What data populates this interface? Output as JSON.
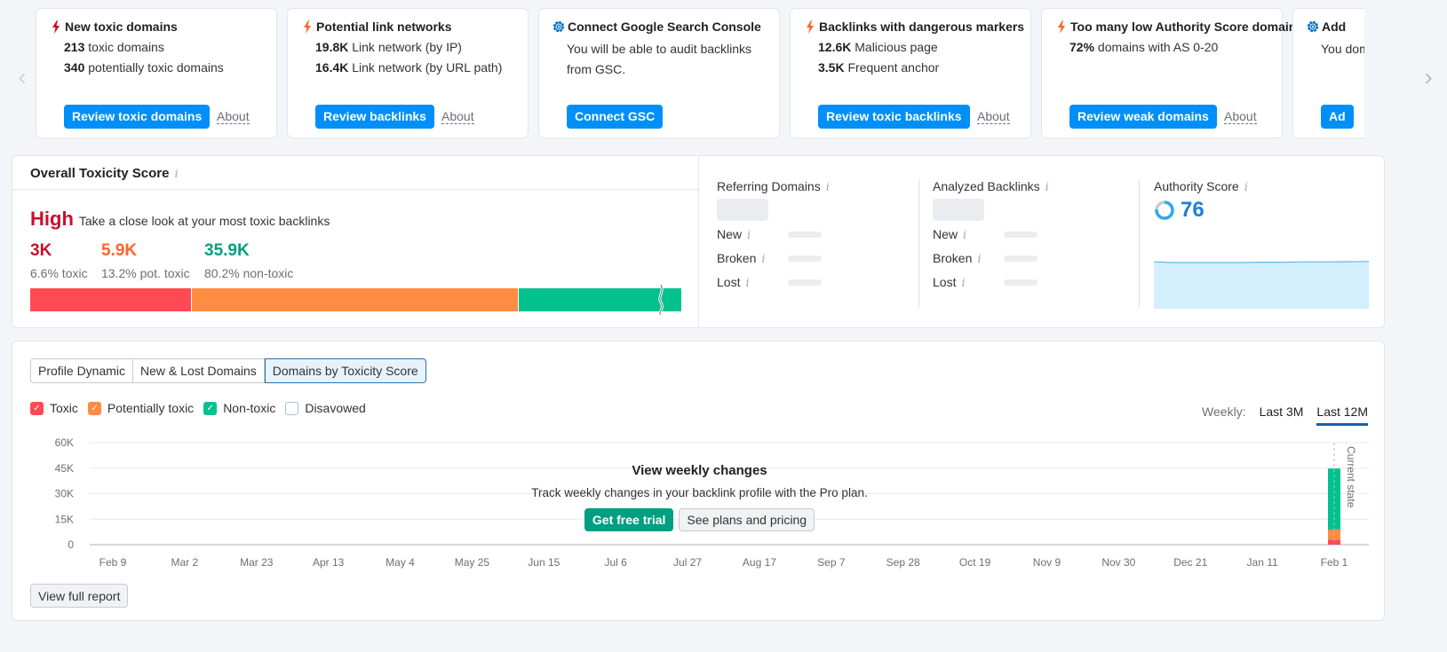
{
  "carousel": {
    "cards": [
      {
        "icon": "lightning-icon",
        "icon_color": "#d1002f",
        "title": "New toxic domains",
        "lines": [
          {
            "value": "213",
            "text": " toxic domains"
          },
          {
            "value": "340",
            "text": " potentially toxic domains"
          }
        ],
        "button": "Review toxic domains",
        "about": "About"
      },
      {
        "icon": "lightning-icon",
        "icon_color": "#ff642d",
        "title": "Potential link networks",
        "lines": [
          {
            "value": "19.8K",
            "text": " Link network (by IP)"
          },
          {
            "value": "16.4K",
            "text": " Link network (by URL path)"
          }
        ],
        "button": "Review backlinks",
        "about": "About"
      },
      {
        "icon": "gear-icon",
        "icon_color": "#006dca",
        "title": "Connect Google Search Console",
        "description": "You will be able to audit backlinks from GSC.",
        "button": "Connect GSC"
      },
      {
        "icon": "lightning-icon",
        "icon_color": "#ff642d",
        "title": "Backlinks with dangerous markers",
        "lines": [
          {
            "value": "12.6K",
            "text": " Malicious page"
          },
          {
            "value": "3.5K",
            "text": " Frequent anchor"
          }
        ],
        "button": "Review toxic backlinks",
        "about": "About"
      },
      {
        "icon": "lightning-icon",
        "icon_color": "#ff642d",
        "title": "Too many low Authority Score domains",
        "lines": [
          {
            "value": "72%",
            "text": " domains with AS 0-20"
          }
        ],
        "button": "Review weak domains",
        "about": "About"
      },
      {
        "icon": "gear-icon",
        "icon_color": "#006dca",
        "title": "Add",
        "description": "You dom",
        "button": "Ad"
      }
    ]
  },
  "toxicity": {
    "title": "Overall Toxicity Score",
    "level": "High",
    "level_text": "Take a close look at your most toxic backlinks",
    "metrics": [
      {
        "value": "3K",
        "label": "6.6% toxic",
        "color": "#c8102e"
      },
      {
        "value": "5.9K",
        "label": "13.2% pot. toxic",
        "color": "#ff642d"
      },
      {
        "value": "35.9K",
        "label": "80.2% non-toxic",
        "color": "#009f81"
      }
    ],
    "bar": [
      {
        "name": "toxic",
        "share": 0.247,
        "color": "#ff4953"
      },
      {
        "name": "potentially-toxic",
        "share": 0.502,
        "color": "#ff8c43"
      },
      {
        "name": "non-toxic",
        "share": 0.251,
        "color": "#00c28f"
      }
    ]
  },
  "stats": {
    "referring_domains": {
      "title": "Referring Domains",
      "rows": [
        "New",
        "Broken",
        "Lost"
      ]
    },
    "analyzed_backlinks": {
      "title": "Analyzed Backlinks",
      "rows": [
        "New",
        "Broken",
        "Lost"
      ]
    },
    "authority_score": {
      "title": "Authority Score",
      "value": "76",
      "ring_fraction": 0.76,
      "trend": [
        76,
        75,
        75,
        75,
        75,
        75.5,
        75.5,
        76,
        76,
        76.3,
        76.5
      ]
    }
  },
  "profile": {
    "tabs": [
      {
        "label": "Profile Dynamic",
        "active": false
      },
      {
        "label": "New & Lost Domains",
        "active": false
      },
      {
        "label": "Domains by Toxicity Score",
        "active": true
      }
    ],
    "legend": [
      {
        "label": "Toxic",
        "checked": true,
        "color": "#ff4953"
      },
      {
        "label": "Potentially toxic",
        "checked": true,
        "color": "#ff8c43"
      },
      {
        "label": "Non-toxic",
        "checked": true,
        "color": "#00c28f"
      },
      {
        "label": "Disavowed",
        "checked": false,
        "color": "#ffffff"
      }
    ],
    "period_label": "Weekly:",
    "periods": [
      {
        "label": "Last 3M",
        "active": false
      },
      {
        "label": "Last 12M",
        "active": true
      }
    ],
    "overlay": {
      "title": "View weekly changes",
      "subtitle": "Track weekly changes in your backlink profile with the Pro plan.",
      "primary": "Get free trial",
      "secondary": "See plans and pricing"
    },
    "view_full_report": "View full report"
  },
  "chart_data": {
    "type": "bar",
    "title": "Domains by Toxicity Score",
    "xlabel": "",
    "ylabel": "",
    "ylim": [
      0,
      60000
    ],
    "yticks": [
      "0",
      "15K",
      "30K",
      "45K",
      "60K"
    ],
    "categories": [
      "Feb 9",
      "Mar 2",
      "Mar 23",
      "Apr 13",
      "May 4",
      "May 25",
      "Jun 15",
      "Jul 6",
      "Jul 27",
      "Aug 17",
      "Sep 7",
      "Sep 28",
      "Oct 19",
      "Nov 9",
      "Nov 30",
      "Dec 21",
      "Jan 11",
      "Feb 1"
    ],
    "grid": true,
    "annotation": "Current state",
    "series": [
      {
        "name": "Toxic",
        "color": "#ff4953",
        "values": [
          null,
          null,
          null,
          null,
          null,
          null,
          null,
          null,
          null,
          null,
          null,
          null,
          null,
          null,
          null,
          null,
          null,
          3000
        ]
      },
      {
        "name": "Potentially toxic",
        "color": "#ff8c43",
        "values": [
          null,
          null,
          null,
          null,
          null,
          null,
          null,
          null,
          null,
          null,
          null,
          null,
          null,
          null,
          null,
          null,
          null,
          5900
        ]
      },
      {
        "name": "Non-toxic",
        "color": "#00c28f",
        "values": [
          null,
          null,
          null,
          null,
          null,
          null,
          null,
          null,
          null,
          null,
          null,
          null,
          null,
          null,
          null,
          null,
          null,
          35900
        ]
      }
    ]
  }
}
